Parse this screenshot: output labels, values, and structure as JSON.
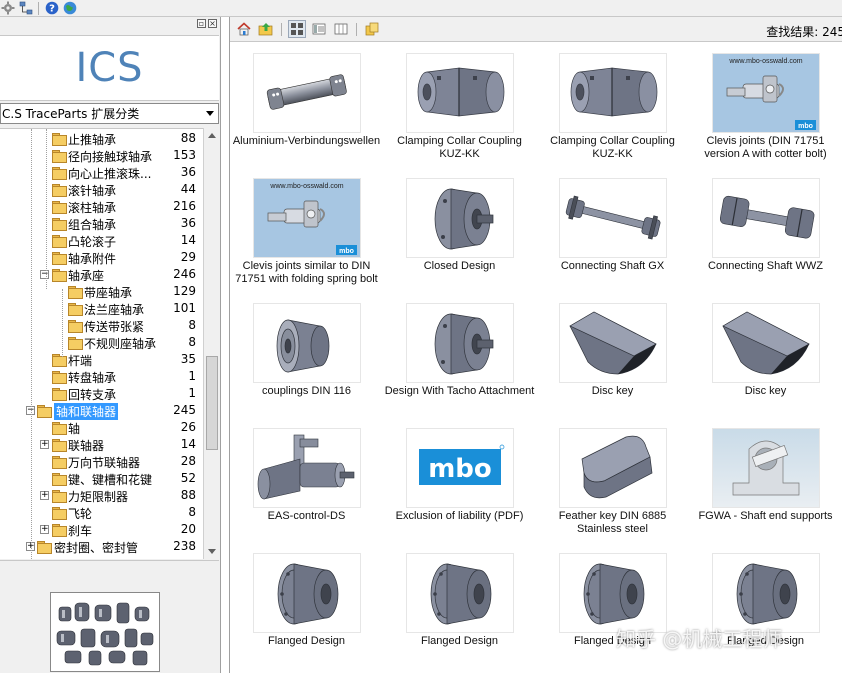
{
  "toolbar": {
    "icons": [
      "gear-icon",
      "network-icon",
      "help-icon",
      "globe-icon"
    ]
  },
  "left_panel": {
    "logo": "ICS",
    "classification_select": "C.S TraceParts 扩展分类",
    "tree": [
      {
        "label": "止推轴承",
        "count": "88"
      },
      {
        "label": "径向接触球轴承",
        "count": "153"
      },
      {
        "label": "向心止推滚珠...",
        "count": "36"
      },
      {
        "label": "滚针轴承",
        "count": "44"
      },
      {
        "label": "滚柱轴承",
        "count": "216"
      },
      {
        "label": "组合轴承",
        "count": "36"
      },
      {
        "label": "凸轮滚子",
        "count": "14"
      },
      {
        "label": "轴承附件",
        "count": "29"
      },
      {
        "label": "轴承座",
        "count": "246"
      },
      {
        "label": "带座轴承",
        "count": "129"
      },
      {
        "label": "法兰座轴承",
        "count": "101"
      },
      {
        "label": "传送带张紧",
        "count": "8"
      },
      {
        "label": "不规则座轴承",
        "count": "8"
      },
      {
        "label": "杆端",
        "count": "35"
      },
      {
        "label": "转盘轴承",
        "count": "1"
      },
      {
        "label": "回转支承",
        "count": "1"
      },
      {
        "label": "轴和联轴器",
        "count": "245"
      },
      {
        "label": "轴",
        "count": "26"
      },
      {
        "label": "联轴器",
        "count": "14"
      },
      {
        "label": "万向节联轴器",
        "count": "28"
      },
      {
        "label": "键、键槽和花键",
        "count": "52"
      },
      {
        "label": "力矩限制器",
        "count": "88"
      },
      {
        "label": "飞轮",
        "count": "8"
      },
      {
        "label": "刹车",
        "count": "20"
      },
      {
        "label": "密封圈、密封管",
        "count": "238"
      }
    ]
  },
  "right_panel": {
    "result_label": "查找结果: 245",
    "items": [
      {
        "caption": "Aluminium-Verbindungswellen",
        "image": "shaft"
      },
      {
        "caption": "Clamping Collar Coupling KUZ-KK",
        "image": "coupling"
      },
      {
        "caption": "Clamping Collar Coupling KUZ-KK",
        "image": "coupling"
      },
      {
        "caption": "Clevis joints (DIN 71751 version A with cotter bolt)",
        "image": "mbo-photo"
      },
      {
        "caption": "Clevis joints similar to DIN 71751 with folding spring bolt",
        "image": "mbo-photo"
      },
      {
        "caption": "Closed Design",
        "image": "clutch"
      },
      {
        "caption": "Connecting Shaft GX",
        "image": "long-shaft"
      },
      {
        "caption": "Connecting Shaft WWZ",
        "image": "coupling-shaft"
      },
      {
        "caption": "couplings DIN 116",
        "image": "pulley"
      },
      {
        "caption": "Design With Tacho Attachment",
        "image": "clutch"
      },
      {
        "caption": "Disc key",
        "image": "disc-key"
      },
      {
        "caption": "Disc key",
        "image": "disc-key"
      },
      {
        "caption": "EAS-control-DS",
        "image": "eas"
      },
      {
        "caption": "Exclusion of liability (PDF)",
        "image": "mbo-logo"
      },
      {
        "caption": "Feather key DIN 6885 Stainless steel",
        "image": "feather-key"
      },
      {
        "caption": "FGWA - Shaft end supports",
        "image": "support-photo"
      },
      {
        "caption": "Flanged Design",
        "image": "flanged"
      },
      {
        "caption": "Flanged Design",
        "image": "flanged"
      },
      {
        "caption": "Flanged Design",
        "image": "flanged"
      },
      {
        "caption": "Flanged Design",
        "image": "flanged"
      }
    ],
    "mbo_url": "www.mbo-osswald.com",
    "mbo_brand": "mbo"
  },
  "watermark": "知乎 @机械工程师",
  "colors": {
    "logo": "#4f83b8",
    "selection": "#3399ff",
    "folder": "#f5cd63",
    "part_gray": "#6e7485",
    "mbo_blue": "#1a8fd8"
  }
}
